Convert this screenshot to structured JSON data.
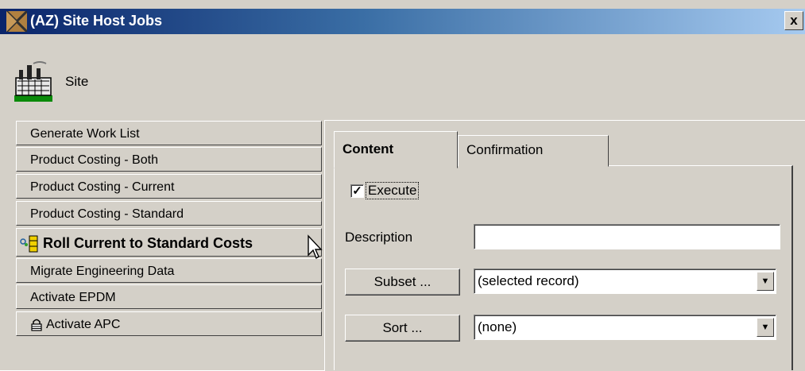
{
  "window": {
    "title": "(AZ) Site Host Jobs",
    "close_label": "x"
  },
  "header": {
    "label": "Site"
  },
  "jobs": [
    "Generate Work List",
    "Product Costing - Both",
    "Product Costing - Current",
    "Product Costing - Standard",
    "Roll Current to Standard Costs",
    "Migrate Engineering Data",
    "Activate EPDM",
    "Activate APC"
  ],
  "selected_job_index": 4,
  "tabs": [
    {
      "label": "Content",
      "active": true
    },
    {
      "label": "Confirmation",
      "active": false
    }
  ],
  "form": {
    "execute_label": "Execute",
    "execute_checked": true,
    "description_label": "Description",
    "description_value": "",
    "subset_button": "Subset ...",
    "subset_value": "(selected record)",
    "sort_button": "Sort ...",
    "sort_value": "(none)"
  },
  "icons": {
    "app": "app-icon",
    "site": "factory-icon",
    "selected_job": "traffic-light-icon",
    "apc": "lock-icon",
    "dropdown": "chevron-down-icon",
    "pointer": "mouse-pointer-icon"
  }
}
